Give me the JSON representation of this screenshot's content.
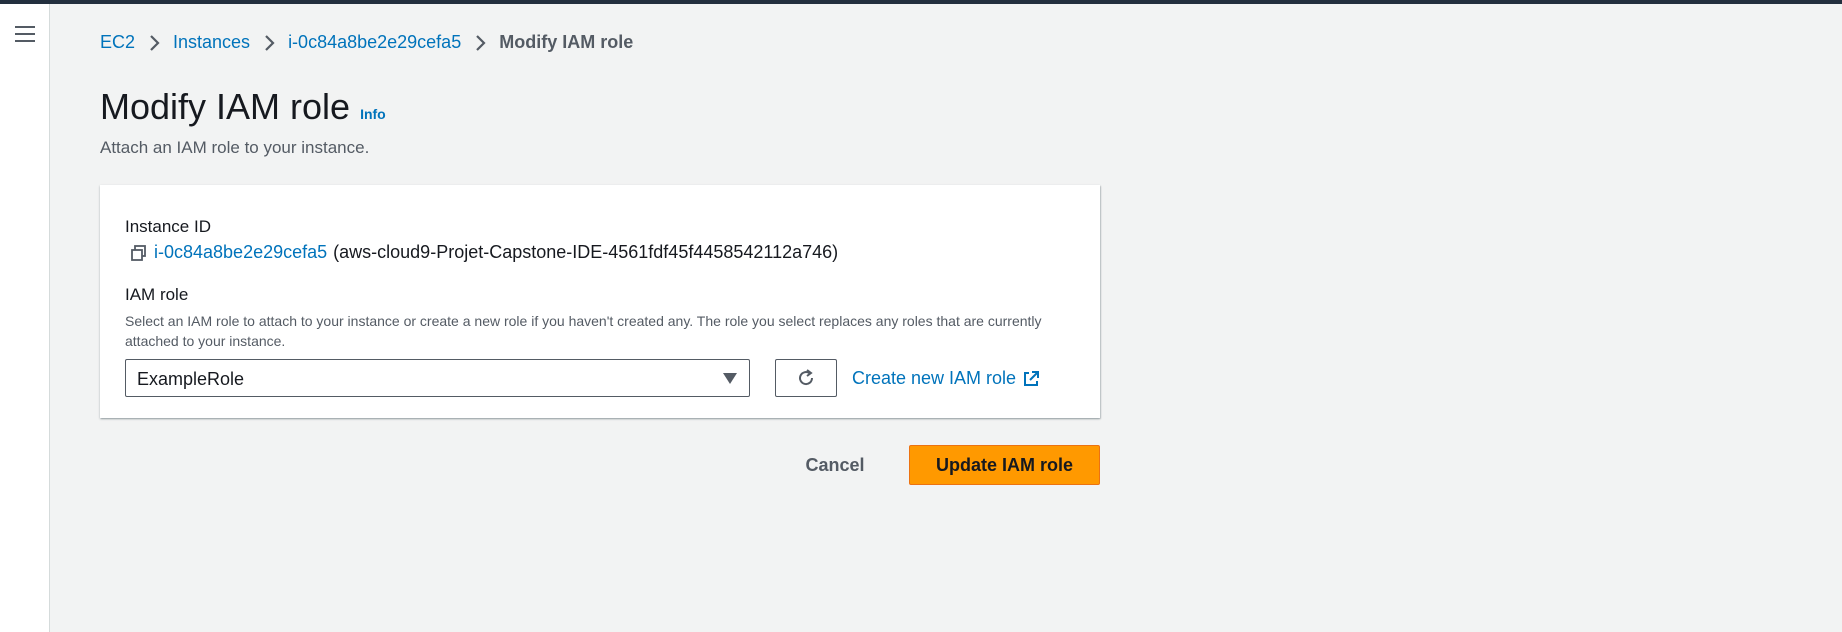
{
  "colors": {
    "accent_link": "#0073bb",
    "primary_button": "#ff9900",
    "background": "#f2f3f3",
    "topbar": "#232f3e"
  },
  "sidenav": {
    "menu_icon": "hamburger-menu-icon"
  },
  "breadcrumb": {
    "items": [
      {
        "label": "EC2"
      },
      {
        "label": "Instances"
      },
      {
        "label": "i-0c84a8be2e29cefa5"
      }
    ],
    "current": "Modify IAM role",
    "separator_icon": "chevron-right-icon"
  },
  "header": {
    "title": "Modify IAM role",
    "info_label": "Info",
    "subtitle": "Attach an IAM role to your instance."
  },
  "form": {
    "instance_id_label": "Instance ID",
    "instance_id": "i-0c84a8be2e29cefa5",
    "instance_name": "(aws-cloud9-Projet-Capstone-IDE-4561fdf45f4458542112a746)",
    "copy_icon": "copy-icon",
    "iam_role_label": "IAM role",
    "iam_role_description": "Select an IAM role to attach to your instance or create a new role if you haven't created any. The role you select replaces any roles that are currently attached to your instance.",
    "iam_role_selected": "ExampleRole",
    "refresh_icon": "refresh-icon",
    "create_role_label": "Create new IAM role",
    "external_icon": "external-link-icon"
  },
  "actions": {
    "cancel_label": "Cancel",
    "update_label": "Update IAM role"
  }
}
